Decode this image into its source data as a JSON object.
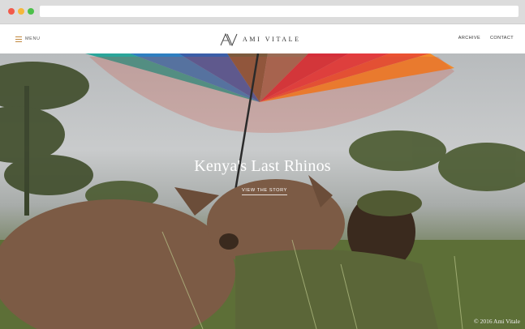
{
  "browser": {
    "controls": [
      "close",
      "minimize",
      "maximize"
    ],
    "url": ""
  },
  "header": {
    "menu_label": "MENU",
    "menu_icon": "hamburger-icon",
    "logo_text": "AMI VITALE",
    "logo_icon": "av-monogram-icon",
    "nav": [
      "ARCHIVE",
      "CONTACT"
    ],
    "accent_color": "#c28a40"
  },
  "hero": {
    "title": "Kenya's Last Rhinos",
    "cta": "VIEW THE STORY",
    "credit": "© 2016 Ami Vitale"
  }
}
